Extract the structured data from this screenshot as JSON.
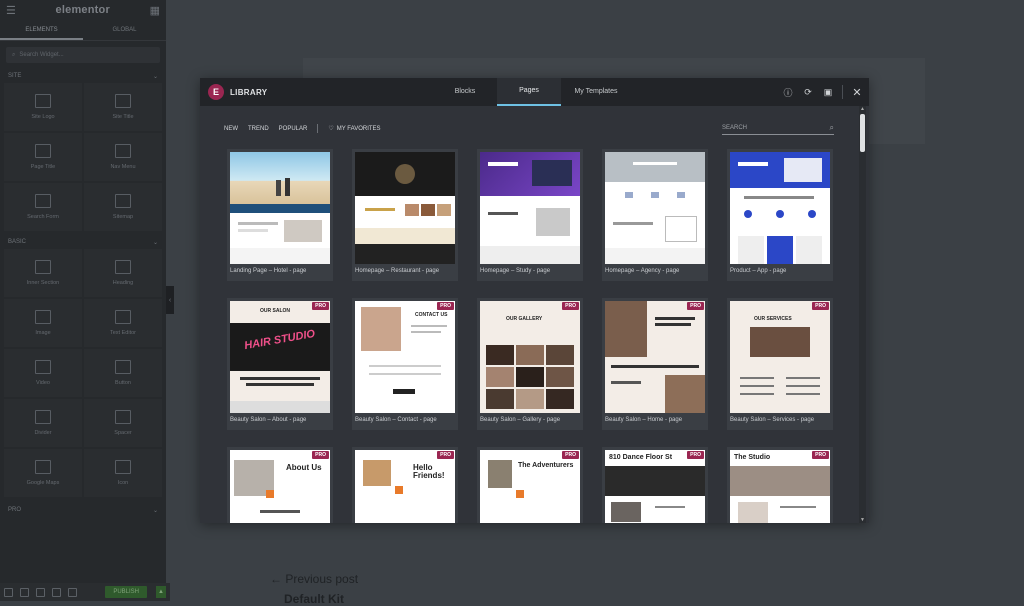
{
  "panel": {
    "logo": "elementor",
    "tabs": [
      "ELEMENTS",
      "GLOBAL"
    ],
    "search_placeholder": "Search Widget...",
    "site_label": "SITE",
    "basic_label": "BASIC",
    "pro_label": "PRO",
    "site_widgets": [
      "Site Logo",
      "Site Title",
      "Page Title",
      "Nav Menu",
      "Search Form",
      "Sitemap"
    ],
    "basic_widgets": [
      "Inner Section",
      "Heading",
      "Image",
      "Text Editor",
      "Video",
      "Button",
      "Divider",
      "Spacer",
      "Google Maps",
      "Icon"
    ],
    "publish": "PUBLISH"
  },
  "canvas": {
    "previous_post": "Previous post",
    "default_kit": "Default Kit"
  },
  "modal": {
    "title": "LIBRARY",
    "tabs": [
      "Blocks",
      "Pages",
      "My Templates"
    ],
    "active_tab": "Pages",
    "filters": [
      "NEW",
      "TREND",
      "POPULAR"
    ],
    "favorites": "MY FAVORITES",
    "search_placeholder": "SEARCH",
    "pro_badge": "PRO",
    "cards": [
      {
        "title": "Landing Page – Hotel - page",
        "pro": false
      },
      {
        "title": "Homepage – Restaurant - page",
        "pro": false
      },
      {
        "title": "Homepage – Study - page",
        "pro": false
      },
      {
        "title": "Homepage – Agency - page",
        "pro": false
      },
      {
        "title": "Product – App - page",
        "pro": false
      },
      {
        "title": "Beauty Salon – About - page",
        "pro": true
      },
      {
        "title": "Beauty Salon – Contact - page",
        "pro": true
      },
      {
        "title": "Beauty Salon – Gallery - page",
        "pro": true
      },
      {
        "title": "Beauty Salon – Home - page",
        "pro": true
      },
      {
        "title": "Beauty Salon – Services - page",
        "pro": true
      },
      {
        "title": "",
        "pro": true
      },
      {
        "title": "",
        "pro": true
      },
      {
        "title": "",
        "pro": true
      },
      {
        "title": "",
        "pro": true
      },
      {
        "title": "",
        "pro": true
      }
    ],
    "thumb_text": {
      "hair_studio": "HAIR STUDIO",
      "about_us": "About Us",
      "hello_friends": "Hello Friends!",
      "adventurers": "The Adventurers",
      "dance_floor": "810 Dance Floor St",
      "the_studio": "The Studio",
      "our_salon": "OUR SALON",
      "contact_us": "CONTACT US",
      "our_gallery": "OUR GALLERY",
      "our_services": "OUR SERVICES"
    }
  }
}
